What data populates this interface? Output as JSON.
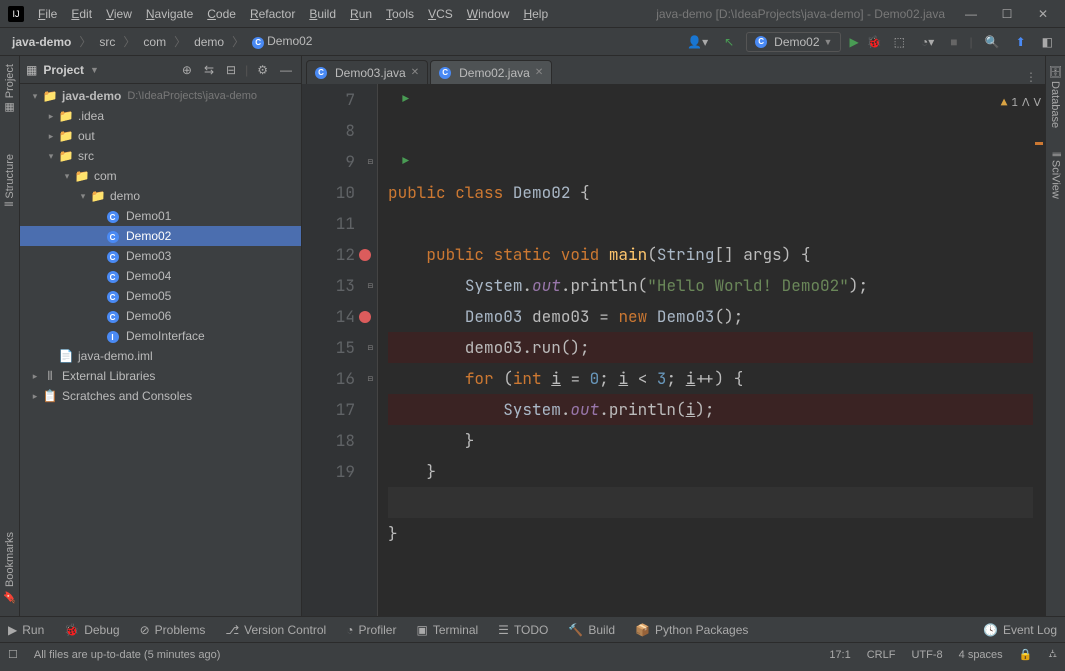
{
  "title": "java-demo [D:\\IdeaProjects\\java-demo] - Demo02.java",
  "menus": [
    "File",
    "Edit",
    "View",
    "Navigate",
    "Code",
    "Refactor",
    "Build",
    "Run",
    "Tools",
    "VCS",
    "Window",
    "Help"
  ],
  "breadcrumbs": [
    "java-demo",
    "src",
    "com",
    "demo",
    "Demo02"
  ],
  "run_config": "Demo02",
  "left_tabs": [
    "Project",
    "Structure",
    "Bookmarks"
  ],
  "right_tabs": [
    "Database",
    "SciView"
  ],
  "sidebar_title": "Project",
  "tree": {
    "root": {
      "name": "java-demo",
      "path": "D:\\IdeaProjects\\java-demo"
    },
    "idea": ".idea",
    "out": "out",
    "src": "src",
    "com": "com",
    "demo": "demo",
    "classes": [
      "Demo01",
      "Demo02",
      "Demo03",
      "Demo04",
      "Demo05",
      "Demo06",
      "DemoInterface"
    ],
    "iml": "java-demo.iml",
    "ext": "External Libraries",
    "scratch": "Scratches and Consoles"
  },
  "tabs": [
    {
      "name": "Demo03.java",
      "active": false
    },
    {
      "name": "Demo02.java",
      "active": true
    }
  ],
  "warnings": "1",
  "lines": [
    {
      "n": 7,
      "run": true,
      "html": "<span class='kw'>public class</span> <span class='cls'>Demo02</span> {"
    },
    {
      "n": 8,
      "html": ""
    },
    {
      "n": 9,
      "run": true,
      "fold": true,
      "html": "    <span class='kw'>public static void</span> <span class='fn'>main</span>(<span class='cls'>String</span>[] args) {"
    },
    {
      "n": 10,
      "html": "        <span class='cls'>System</span>.<span class='fld'>out</span>.println(<span class='str'>\"Hello World! Demo02\"</span>);"
    },
    {
      "n": 11,
      "html": "        <span class='cls'>Demo03</span> demo03 = <span class='kw'>new</span> <span class='cls'>Demo03</span>();"
    },
    {
      "n": 12,
      "bp": true,
      "html": "        demo03.run();"
    },
    {
      "n": 13,
      "fold": true,
      "html": "        <span class='kw'>for</span> (<span class='kw'>int</span> <u>i</u> = <span class='num'>0</span>; <u>i</u> < <span class='num'>3</span>; <u>i</u>++) {"
    },
    {
      "n": 14,
      "bp": true,
      "html": "            <span class='cls'>System</span>.<span class='fld'>out</span>.println(<u>i</u>);"
    },
    {
      "n": 15,
      "fold": true,
      "html": "        }"
    },
    {
      "n": 16,
      "fold": true,
      "html": "    }"
    },
    {
      "n": 17,
      "caret": true,
      "html": ""
    },
    {
      "n": 18,
      "html": "}"
    },
    {
      "n": 19,
      "html": ""
    }
  ],
  "bottom": [
    "Run",
    "Debug",
    "Problems",
    "Version Control",
    "Profiler",
    "Terminal",
    "TODO",
    "Build",
    "Python Packages"
  ],
  "bottom_right": "Event Log",
  "status_msg": "All files are up-to-date (5 minutes ago)",
  "status_right": [
    "17:1",
    "CRLF",
    "UTF-8",
    "4 spaces"
  ]
}
